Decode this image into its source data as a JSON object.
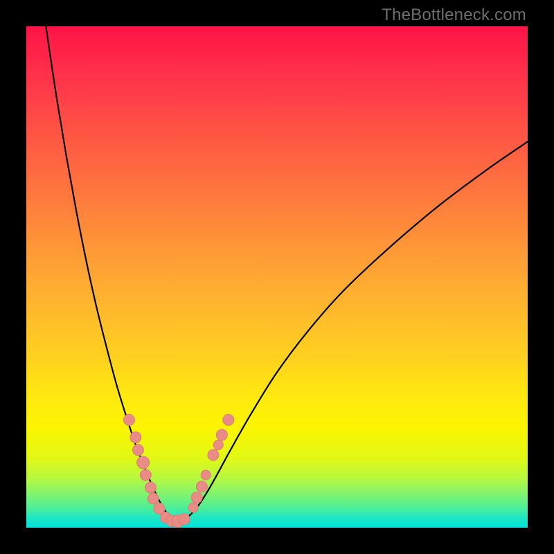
{
  "watermark": "TheBottleneck.com",
  "colors": {
    "frame": "#000000",
    "curve": "#000000",
    "dots": "#e98c86"
  },
  "chart_data": {
    "type": "line",
    "title": "",
    "xlabel": "",
    "ylabel": "",
    "xlim": [
      0,
      100
    ],
    "ylim": [
      0,
      100
    ],
    "grid": false,
    "legend": false,
    "note": "Axis values are fractional positions in the 724×724 plot area (0=left/top, 100=right/bottom). Curve descends steeply from upper-left, bottoms out near x≈29, then rises with diminishing slope toward upper-right.",
    "series": [
      {
        "name": "bottleneck-curve",
        "x": [
          3.9,
          6.0,
          8.0,
          10.0,
          12.0,
          14.0,
          16.0,
          18.0,
          20.0,
          22.0,
          24.0,
          25.5,
          27.0,
          28.5,
          30.0,
          32.0,
          34.0,
          36.0,
          38.0,
          41.0,
          45.0,
          50.0,
          56.0,
          63.0,
          72.0,
          82.0,
          92.0,
          100.0
        ],
        "y": [
          0.0,
          14.0,
          26.0,
          37.0,
          47.0,
          56.0,
          64.0,
          71.5,
          78.0,
          84.0,
          89.0,
          92.5,
          95.5,
          97.7,
          98.8,
          98.0,
          96.0,
          93.0,
          89.5,
          84.0,
          77.0,
          69.0,
          61.0,
          53.0,
          44.5,
          36.0,
          28.5,
          23.0
        ]
      }
    ],
    "markers_left": [
      {
        "x": 20.5,
        "y": 78.5,
        "r": 8
      },
      {
        "x": 21.8,
        "y": 82.0,
        "r": 8
      },
      {
        "x": 22.3,
        "y": 84.5,
        "r": 8
      },
      {
        "x": 23.3,
        "y": 87.0,
        "r": 9
      },
      {
        "x": 23.8,
        "y": 89.5,
        "r": 8
      },
      {
        "x": 24.8,
        "y": 92.0,
        "r": 8
      },
      {
        "x": 25.3,
        "y": 94.2,
        "r": 8
      },
      {
        "x": 26.5,
        "y": 96.2,
        "r": 8
      }
    ],
    "markers_bottom": [
      {
        "x": 27.8,
        "y": 98.0,
        "r": 8
      },
      {
        "x": 29.0,
        "y": 98.7,
        "r": 8
      },
      {
        "x": 30.2,
        "y": 98.7,
        "r": 9
      },
      {
        "x": 31.5,
        "y": 98.3,
        "r": 8
      }
    ],
    "markers_right": [
      {
        "x": 33.3,
        "y": 96.0,
        "r": 7
      },
      {
        "x": 34.0,
        "y": 94.0,
        "r": 8
      },
      {
        "x": 35.0,
        "y": 91.8,
        "r": 8
      },
      {
        "x": 35.8,
        "y": 89.5,
        "r": 7
      },
      {
        "x": 37.3,
        "y": 85.5,
        "r": 8
      },
      {
        "x": 38.3,
        "y": 83.5,
        "r": 7
      },
      {
        "x": 39.0,
        "y": 81.5,
        "r": 8
      },
      {
        "x": 40.3,
        "y": 78.5,
        "r": 8
      }
    ]
  }
}
